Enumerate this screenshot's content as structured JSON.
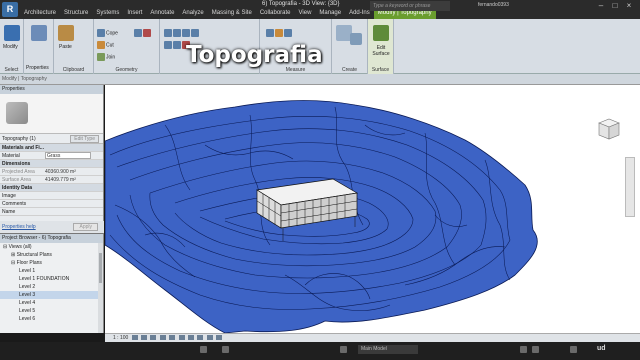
{
  "app": {
    "logo": "R",
    "doc_title": "6) Topografia - 3D View: {3D}",
    "search_placeholder": "Type a keyword or phrase",
    "user": "fernando0393"
  },
  "menu": {
    "tabs": [
      "Architecture",
      "Structure",
      "Systems",
      "Insert",
      "Annotate",
      "Analyze",
      "Massing & Site",
      "Collaborate",
      "View",
      "Manage",
      "Add-Ins"
    ],
    "context_tab": "Modify | Topography"
  },
  "ribbon": {
    "select": {
      "label": "Select",
      "modify": "Modify"
    },
    "properties": {
      "label": "Properties",
      "button": "Properties"
    },
    "clipboard": {
      "label": "Clipboard",
      "paste": "Paste",
      "cope": "Cope",
      "cut": "Cut",
      "join": "Join"
    },
    "geometry": {
      "label": "Geometry"
    },
    "measure": {
      "label": "Measure"
    },
    "create": {
      "label": "Create"
    },
    "surface": {
      "label": "Surface",
      "edit_surface": "Edit Surface"
    }
  },
  "watermark": "Topografia",
  "options_bar": {
    "text": "Modify | Topography"
  },
  "properties_panel": {
    "title": "Properties",
    "type_selector": "Topography (1)",
    "edit_type": "Edit Type",
    "sections": [
      {
        "header": "Materials and Fi...",
        "rows": [
          {
            "name": "Material",
            "value": "Grass",
            "field": true
          }
        ]
      },
      {
        "header": "Dimensions",
        "rows": [
          {
            "name": "Projected Area",
            "value": "40360.900 m²",
            "field": false,
            "dim": true
          },
          {
            "name": "Surface Area",
            "value": "41409.779 m²",
            "field": false,
            "dim": true
          }
        ]
      },
      {
        "header": "Identity Data",
        "rows": [
          {
            "name": "Image",
            "value": "",
            "field": false,
            "dim": false
          },
          {
            "name": "Comments",
            "value": "",
            "field": false,
            "dim": false
          },
          {
            "name": "Name",
            "value": "",
            "field": false,
            "dim": false
          }
        ]
      }
    ],
    "help_link": "Properties help",
    "apply": "Apply"
  },
  "project_browser": {
    "title": "Project Browser - 6) Topografia",
    "items": [
      {
        "text": "Views (all)",
        "indent": 0,
        "sign": "⊟"
      },
      {
        "text": "Structural Plans",
        "indent": 1,
        "sign": "⊞"
      },
      {
        "text": "Floor Plans",
        "indent": 1,
        "sign": "⊟"
      },
      {
        "text": "Level 1",
        "indent": 2,
        "sign": ""
      },
      {
        "text": "Level 1 FOUNDATION",
        "indent": 2,
        "sign": ""
      },
      {
        "text": "Level 2",
        "indent": 2,
        "sign": ""
      },
      {
        "text": "Level 3",
        "indent": 2,
        "sign": "",
        "selected": true
      },
      {
        "text": "Level 4",
        "indent": 2,
        "sign": ""
      },
      {
        "text": "Level 5",
        "indent": 2,
        "sign": ""
      },
      {
        "text": "Level 6",
        "indent": 2,
        "sign": ""
      }
    ]
  },
  "view_control": {
    "scale": "1 : 100"
  },
  "status_bar": {
    "model": "Main Model",
    "brand": "ud"
  },
  "colors": {
    "terrain": "#3d63c5",
    "contour": "#0a1a55",
    "ribbon_context": "#6a9d2e"
  }
}
